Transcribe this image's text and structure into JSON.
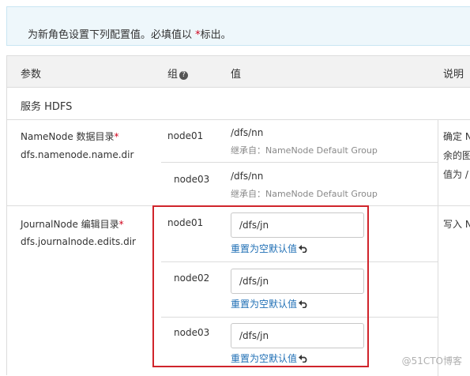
{
  "banner": {
    "text_before": "为新角色设置下列配置值。必填值以 ",
    "star": "*",
    "text_after": "标出。"
  },
  "table": {
    "headers": {
      "param": "参数",
      "group": "组",
      "value": "值",
      "desc": "说明"
    },
    "section_title": "服务 HDFS",
    "namenode": {
      "label": "NameNode 数据目录",
      "star": "*",
      "key": "dfs.namenode.name.dir",
      "rows": [
        {
          "group": "node01",
          "value": "/dfs/nn",
          "inherit": "继承自：NameNode Default Group"
        },
        {
          "group": "node03",
          "value": "/dfs/nn",
          "inherit": "继承自：NameNode Default Group"
        }
      ],
      "desc_lines": [
        "确定 N",
        "余的图",
        "值为 /"
      ]
    },
    "journalnode": {
      "label": "JournalNode 编辑目录",
      "star": "*",
      "key": "dfs.journalnode.edits.dir",
      "rows": [
        {
          "group": "node01",
          "value": "/dfs/jn",
          "reset": "重置为空默认值"
        },
        {
          "group": "node02",
          "value": "/dfs/jn",
          "reset": "重置为空默认值"
        },
        {
          "group": "node03",
          "value": "/dfs/jn",
          "reset": "重置为空默认值"
        }
      ],
      "desc_lines": [
        "写入 N"
      ]
    }
  },
  "icons": {
    "help": "help-icon",
    "undo": "undo-icon"
  },
  "colors": {
    "highlight": "#d0242b",
    "link": "#1f6fb5",
    "required": "#d0021b"
  },
  "watermark": "@51CTO博客"
}
